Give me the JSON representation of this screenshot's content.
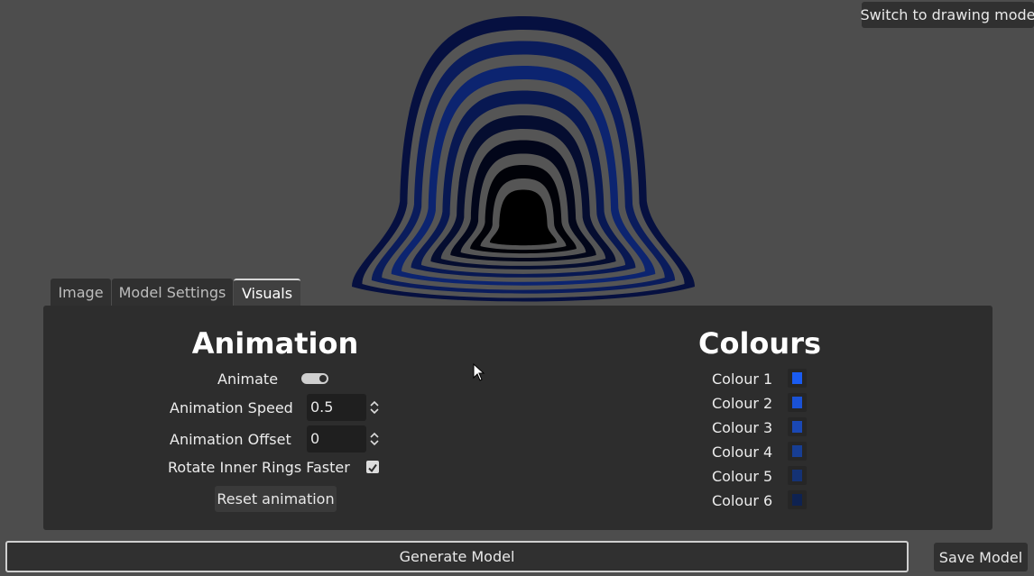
{
  "toolbar": {
    "switch_mode_label": "Switch to drawing mode",
    "generate_label": "Generate Model",
    "save_label": "Save Model"
  },
  "tabs": [
    {
      "label": "Image",
      "active": false
    },
    {
      "label": "Model Settings",
      "active": false
    },
    {
      "label": "Visuals",
      "active": true
    }
  ],
  "animation": {
    "heading": "Animation",
    "animate_label": "Animate",
    "animate_on": true,
    "speed_label": "Animation Speed",
    "speed_value": "0.5",
    "offset_label": "Animation Offset",
    "offset_value": "0",
    "rotate_label": "Rotate Inner Rings Faster",
    "rotate_checked": true,
    "reset_label": "Reset animation"
  },
  "colours": {
    "heading": "Colours",
    "items": [
      {
        "label": "Colour 1",
        "color": "#1a5cf2"
      },
      {
        "label": "Colour 2",
        "color": "#1a52d6"
      },
      {
        "label": "Colour 3",
        "color": "#1a48b4"
      },
      {
        "label": "Colour 4",
        "color": "#173e94"
      },
      {
        "label": "Colour 5",
        "color": "#143275"
      },
      {
        "label": "Colour 6",
        "color": "#0e2251"
      }
    ]
  },
  "preview": {
    "ring_colors": [
      "#061040",
      "#0a1c5c",
      "#0c2470",
      "#081852",
      "#050d30",
      "#02061a",
      "#010208",
      "#000000"
    ],
    "gap_color": "#555555"
  }
}
